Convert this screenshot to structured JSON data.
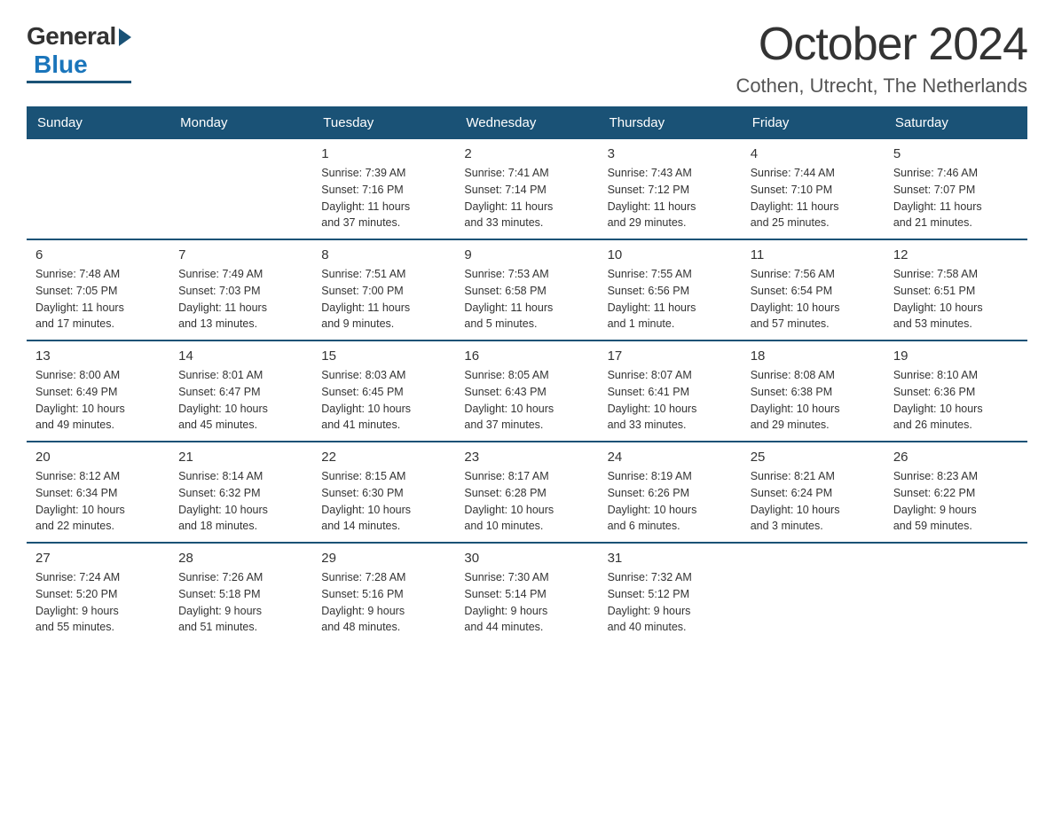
{
  "logo": {
    "general": "General",
    "blue": "Blue"
  },
  "title": "October 2024",
  "subtitle": "Cothen, Utrecht, The Netherlands",
  "weekdays": [
    "Sunday",
    "Monday",
    "Tuesday",
    "Wednesday",
    "Thursday",
    "Friday",
    "Saturday"
  ],
  "weeks": [
    [
      {
        "day": "",
        "info": ""
      },
      {
        "day": "",
        "info": ""
      },
      {
        "day": "1",
        "info": "Sunrise: 7:39 AM\nSunset: 7:16 PM\nDaylight: 11 hours\nand 37 minutes."
      },
      {
        "day": "2",
        "info": "Sunrise: 7:41 AM\nSunset: 7:14 PM\nDaylight: 11 hours\nand 33 minutes."
      },
      {
        "day": "3",
        "info": "Sunrise: 7:43 AM\nSunset: 7:12 PM\nDaylight: 11 hours\nand 29 minutes."
      },
      {
        "day": "4",
        "info": "Sunrise: 7:44 AM\nSunset: 7:10 PM\nDaylight: 11 hours\nand 25 minutes."
      },
      {
        "day": "5",
        "info": "Sunrise: 7:46 AM\nSunset: 7:07 PM\nDaylight: 11 hours\nand 21 minutes."
      }
    ],
    [
      {
        "day": "6",
        "info": "Sunrise: 7:48 AM\nSunset: 7:05 PM\nDaylight: 11 hours\nand 17 minutes."
      },
      {
        "day": "7",
        "info": "Sunrise: 7:49 AM\nSunset: 7:03 PM\nDaylight: 11 hours\nand 13 minutes."
      },
      {
        "day": "8",
        "info": "Sunrise: 7:51 AM\nSunset: 7:00 PM\nDaylight: 11 hours\nand 9 minutes."
      },
      {
        "day": "9",
        "info": "Sunrise: 7:53 AM\nSunset: 6:58 PM\nDaylight: 11 hours\nand 5 minutes."
      },
      {
        "day": "10",
        "info": "Sunrise: 7:55 AM\nSunset: 6:56 PM\nDaylight: 11 hours\nand 1 minute."
      },
      {
        "day": "11",
        "info": "Sunrise: 7:56 AM\nSunset: 6:54 PM\nDaylight: 10 hours\nand 57 minutes."
      },
      {
        "day": "12",
        "info": "Sunrise: 7:58 AM\nSunset: 6:51 PM\nDaylight: 10 hours\nand 53 minutes."
      }
    ],
    [
      {
        "day": "13",
        "info": "Sunrise: 8:00 AM\nSunset: 6:49 PM\nDaylight: 10 hours\nand 49 minutes."
      },
      {
        "day": "14",
        "info": "Sunrise: 8:01 AM\nSunset: 6:47 PM\nDaylight: 10 hours\nand 45 minutes."
      },
      {
        "day": "15",
        "info": "Sunrise: 8:03 AM\nSunset: 6:45 PM\nDaylight: 10 hours\nand 41 minutes."
      },
      {
        "day": "16",
        "info": "Sunrise: 8:05 AM\nSunset: 6:43 PM\nDaylight: 10 hours\nand 37 minutes."
      },
      {
        "day": "17",
        "info": "Sunrise: 8:07 AM\nSunset: 6:41 PM\nDaylight: 10 hours\nand 33 minutes."
      },
      {
        "day": "18",
        "info": "Sunrise: 8:08 AM\nSunset: 6:38 PM\nDaylight: 10 hours\nand 29 minutes."
      },
      {
        "day": "19",
        "info": "Sunrise: 8:10 AM\nSunset: 6:36 PM\nDaylight: 10 hours\nand 26 minutes."
      }
    ],
    [
      {
        "day": "20",
        "info": "Sunrise: 8:12 AM\nSunset: 6:34 PM\nDaylight: 10 hours\nand 22 minutes."
      },
      {
        "day": "21",
        "info": "Sunrise: 8:14 AM\nSunset: 6:32 PM\nDaylight: 10 hours\nand 18 minutes."
      },
      {
        "day": "22",
        "info": "Sunrise: 8:15 AM\nSunset: 6:30 PM\nDaylight: 10 hours\nand 14 minutes."
      },
      {
        "day": "23",
        "info": "Sunrise: 8:17 AM\nSunset: 6:28 PM\nDaylight: 10 hours\nand 10 minutes."
      },
      {
        "day": "24",
        "info": "Sunrise: 8:19 AM\nSunset: 6:26 PM\nDaylight: 10 hours\nand 6 minutes."
      },
      {
        "day": "25",
        "info": "Sunrise: 8:21 AM\nSunset: 6:24 PM\nDaylight: 10 hours\nand 3 minutes."
      },
      {
        "day": "26",
        "info": "Sunrise: 8:23 AM\nSunset: 6:22 PM\nDaylight: 9 hours\nand 59 minutes."
      }
    ],
    [
      {
        "day": "27",
        "info": "Sunrise: 7:24 AM\nSunset: 5:20 PM\nDaylight: 9 hours\nand 55 minutes."
      },
      {
        "day": "28",
        "info": "Sunrise: 7:26 AM\nSunset: 5:18 PM\nDaylight: 9 hours\nand 51 minutes."
      },
      {
        "day": "29",
        "info": "Sunrise: 7:28 AM\nSunset: 5:16 PM\nDaylight: 9 hours\nand 48 minutes."
      },
      {
        "day": "30",
        "info": "Sunrise: 7:30 AM\nSunset: 5:14 PM\nDaylight: 9 hours\nand 44 minutes."
      },
      {
        "day": "31",
        "info": "Sunrise: 7:32 AM\nSunset: 5:12 PM\nDaylight: 9 hours\nand 40 minutes."
      },
      {
        "day": "",
        "info": ""
      },
      {
        "day": "",
        "info": ""
      }
    ]
  ]
}
